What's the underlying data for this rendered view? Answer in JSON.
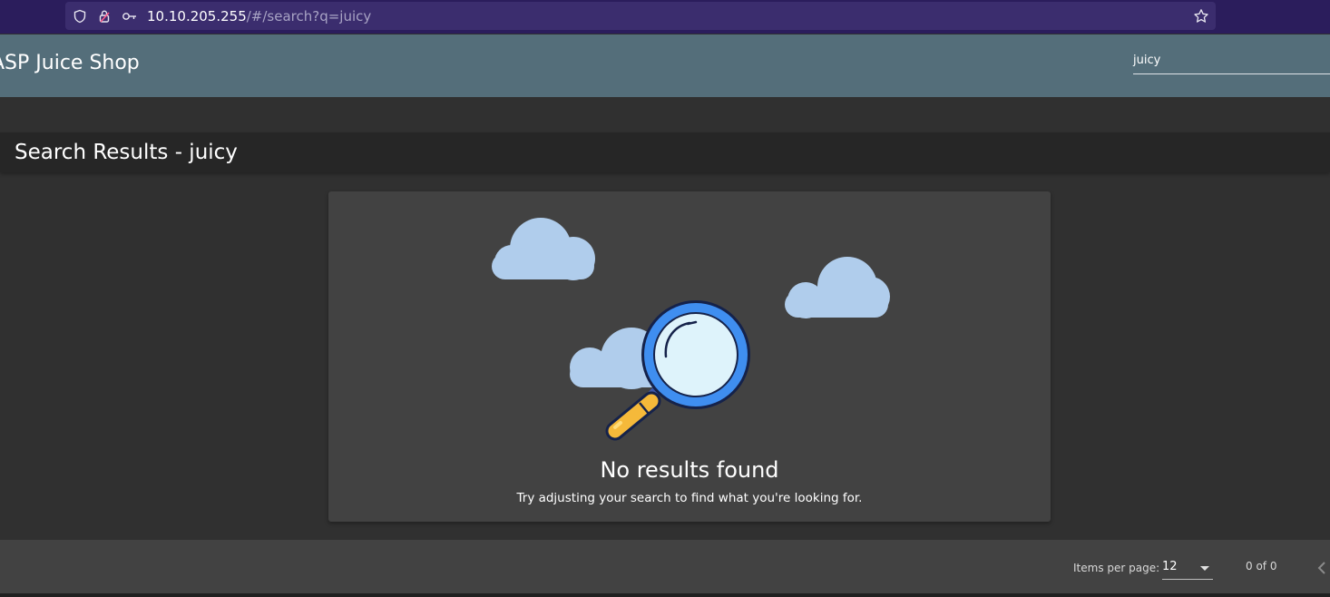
{
  "browser": {
    "url_host": "10.10.205.255",
    "url_path": "/#/search?q=juicy",
    "icons": [
      "shield-icon",
      "lock-icon",
      "key-icon",
      "star-icon"
    ]
  },
  "toolbar": {
    "app_title": "ASP Juice Shop",
    "search_value": "juicy"
  },
  "page": {
    "heading": "Search Results - juicy"
  },
  "results": {
    "empty_title": "No results found",
    "empty_message": "Try adjusting your search to find what you're looking for."
  },
  "paginator": {
    "items_per_page_label": "Items per page:",
    "items_per_page_value": "12",
    "range_label": "0 of 0"
  },
  "colors": {
    "toolbar": "#546e7a",
    "browser_bar": "#2b1d5c",
    "background": "#303030",
    "card": "#424242"
  }
}
